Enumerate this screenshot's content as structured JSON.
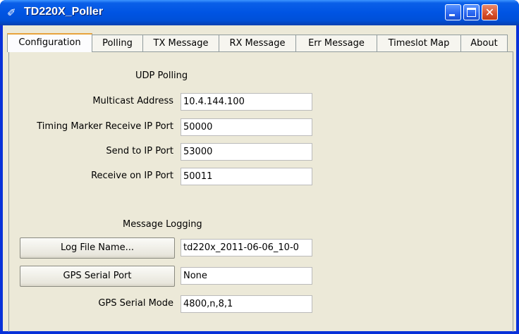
{
  "window": {
    "title": "TD220X_Poller",
    "icon": "feather-icon"
  },
  "tabs": [
    {
      "label": "Configuration",
      "active": true
    },
    {
      "label": "Polling"
    },
    {
      "label": "TX Message"
    },
    {
      "label": "RX Message"
    },
    {
      "label": "Err Message"
    },
    {
      "label": "Timeslot Map"
    },
    {
      "label": "About"
    }
  ],
  "udp": {
    "heading": "UDP Polling",
    "multicast_label": "Multicast Address",
    "multicast_value": "10.4.144.100",
    "timing_label": "Timing Marker Receive IP Port",
    "timing_value": "50000",
    "send_label": "Send to IP Port",
    "send_value": "53000",
    "receive_label": "Receive on IP Port",
    "receive_value": "50011"
  },
  "logging": {
    "heading": "Message Logging",
    "log_file_button": "Log File Name...",
    "log_file_value": "td220x_2011-06-06_10-0",
    "gps_port_button": "GPS Serial Port",
    "gps_port_value": "None",
    "gps_mode_label": "GPS Serial Mode",
    "gps_mode_value": "4800,n,8,1"
  },
  "colors": {
    "titlebar": "#0054e3",
    "client": "#ece9d8",
    "active_tab_accent": "#e8a33d",
    "close_button": "#d8512c"
  }
}
